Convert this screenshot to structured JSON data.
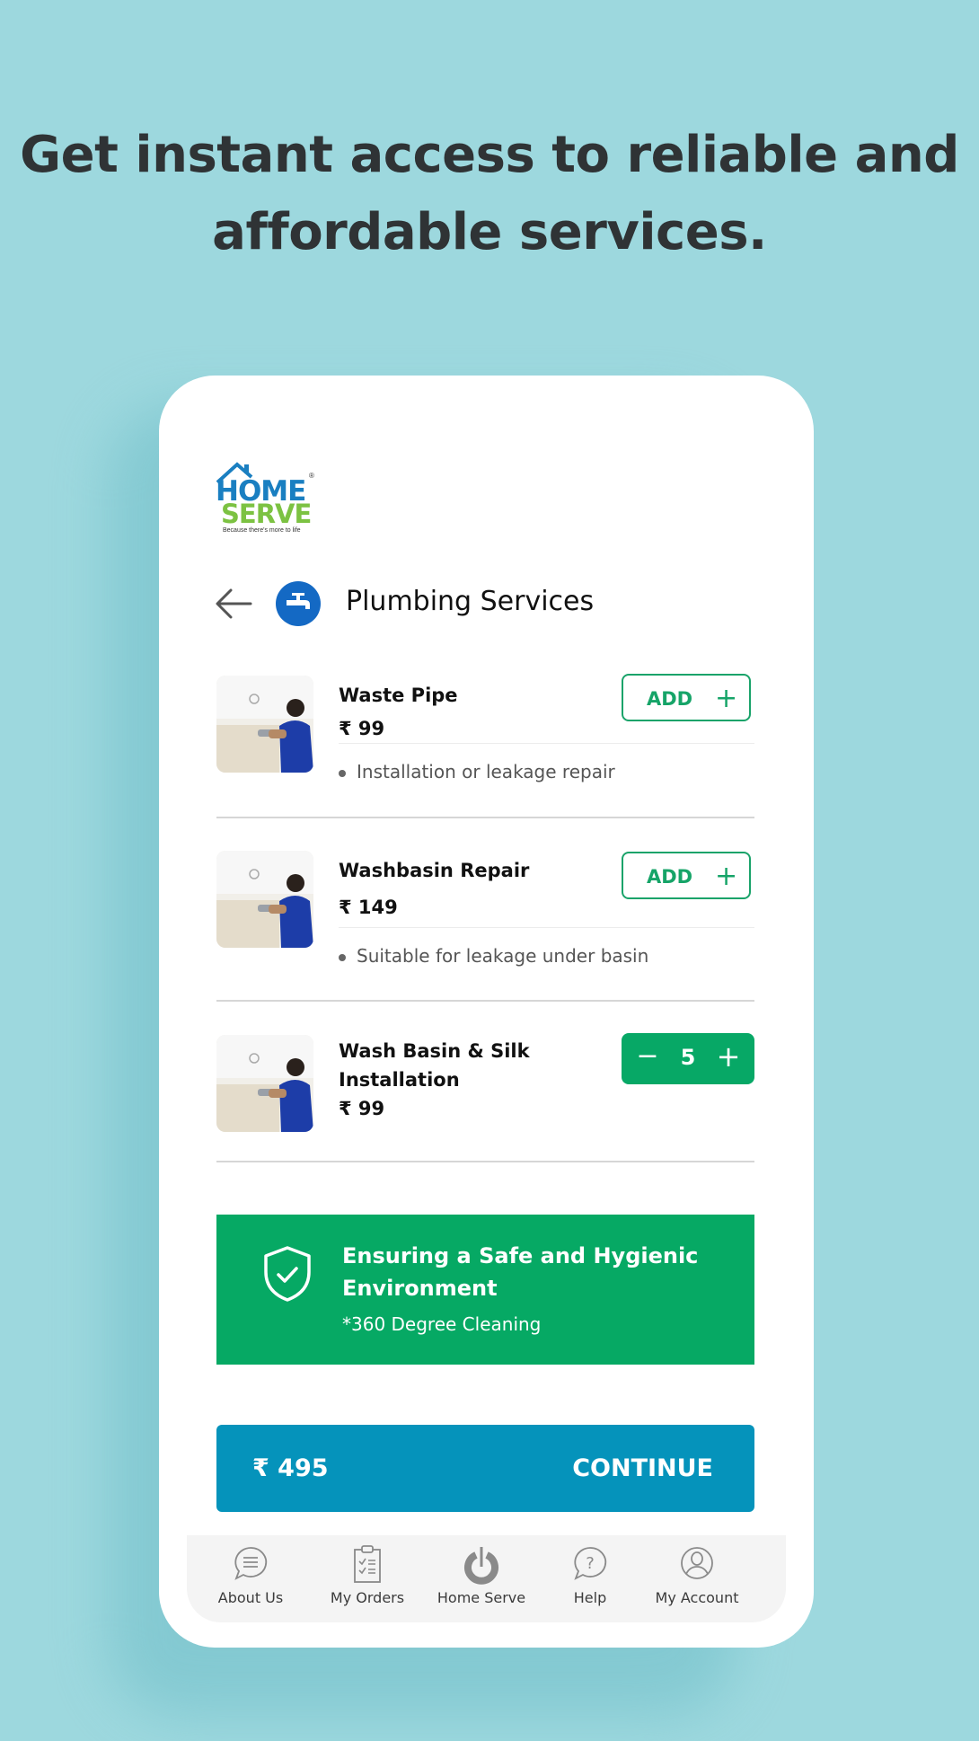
{
  "headline": {
    "line1": "Get instant access to reliable and",
    "line2": "affordable services."
  },
  "logo": {
    "brand_top": "HOME",
    "brand_bottom": "SERVE",
    "tagline": "Because there's more to life",
    "registered": "®"
  },
  "header": {
    "back_icon": "arrow-left-icon",
    "category_icon": "faucet-icon",
    "title": "Plumbing Services"
  },
  "items": [
    {
      "name": "Waste Pipe",
      "price": "₹ 99",
      "description": "Installation or leakage repair",
      "action": "add",
      "add_label": "ADD",
      "add_icon": "+"
    },
    {
      "name": "Washbasin Repair",
      "price": "₹ 149",
      "description": "Suitable for leakage under basin",
      "action": "add",
      "add_label": "ADD",
      "add_icon": "+"
    },
    {
      "name_line1": "Wash Basin & Silk",
      "name_line2": "Installation",
      "price": "₹ 99",
      "action": "stepper",
      "minus_icon": "−",
      "quantity": "5",
      "plus_icon": "+"
    }
  ],
  "banner": {
    "icon": "shield-check-icon",
    "title_line1": "Ensuring a Safe and Hygienic",
    "title_line2": "Environment",
    "subtitle": "*360 Degree Cleaning"
  },
  "checkout": {
    "total": "₹ 495",
    "continue_label": "CONTINUE"
  },
  "bottom_nav": [
    {
      "label": "About Us",
      "icon": "chat-bubble-icon"
    },
    {
      "label": "My Orders",
      "icon": "clipboard-checklist-icon"
    },
    {
      "label": "Home Serve",
      "icon": "power-icon"
    },
    {
      "label": "Help",
      "icon": "help-bubble-icon"
    },
    {
      "label": "My Account",
      "icon": "user-circle-icon"
    }
  ],
  "colors": {
    "background": "#9dd8de",
    "brand_blue": "#1469c4",
    "brand_green": "#06a964",
    "continue_blue": "#0593bb",
    "add_green": "#16a468"
  }
}
